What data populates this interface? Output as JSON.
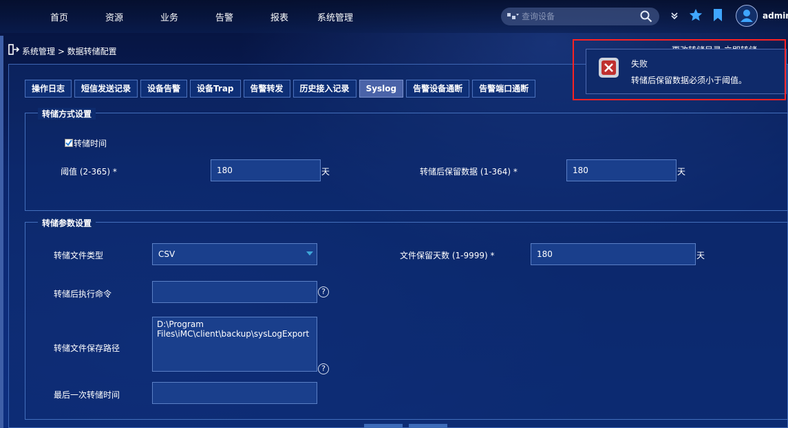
{
  "nav": {
    "items": [
      "首页",
      "资源",
      "业务",
      "告警",
      "报表",
      "系统管理"
    ],
    "search_placeholder": "查询设备",
    "username": "admin"
  },
  "breadcrumb": "系统管理 > 数据转储配置",
  "top_links": "更改转储目录  立即转储",
  "tabs": [
    {
      "label": "操作日志",
      "active": false
    },
    {
      "label": "短信发送记录",
      "active": false
    },
    {
      "label": "设备告警",
      "active": false
    },
    {
      "label": "设备Trap",
      "active": false
    },
    {
      "label": "告警转发",
      "active": false
    },
    {
      "label": "历史接入记录",
      "active": false
    },
    {
      "label": "Syslog",
      "active": true
    },
    {
      "label": "告警设备通断",
      "active": false
    },
    {
      "label": "告警端口通断",
      "active": false
    }
  ],
  "dump_mode": {
    "legend": "转储方式设置",
    "checkbox_label": "转储时间",
    "checkbox_checked": true,
    "threshold_label": "阈值 (2-365) *",
    "threshold_value": "180",
    "threshold_unit": "天",
    "keep_label": "转储后保留数据 (1-364) *",
    "keep_value": "180",
    "keep_unit": "天"
  },
  "dump_params": {
    "legend": "转储参数设置",
    "file_type_label": "转储文件类型",
    "file_type_value": "CSV",
    "file_keep_label": "文件保留天数 (1-9999) *",
    "file_keep_value": "180",
    "file_keep_unit": "天",
    "command_label": "转储后执行命令",
    "command_value": "",
    "path_label": "转储文件保存路径",
    "path_line1": "D:\\Program",
    "path_line2": "Files\\iMC\\client\\backup\\sysLogExport",
    "last_time_label": "最后一次转储时间",
    "last_time_value": ""
  },
  "toast": {
    "title": "失败",
    "message": "转储后保留数据必须小于阈值。"
  },
  "colors": {
    "alert_frame": "#ff2222",
    "accent": "#3fa6d8",
    "active_tab": "#4a63a8"
  }
}
